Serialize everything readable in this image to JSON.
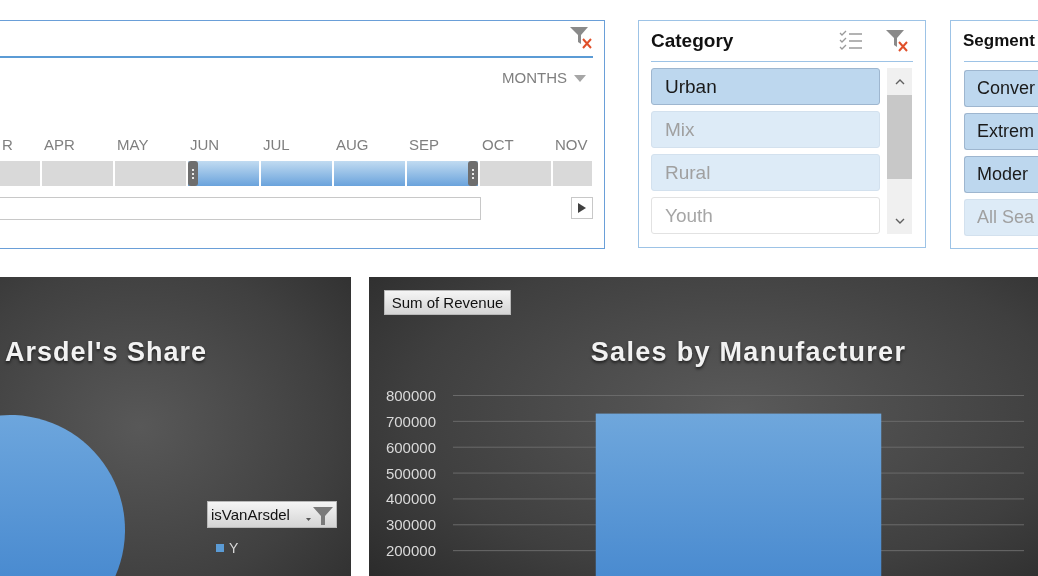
{
  "timeline": {
    "period_label": "MONTHS",
    "months": [
      {
        "label": "R",
        "selected": false
      },
      {
        "label": "APR",
        "selected": false
      },
      {
        "label": "MAY",
        "selected": false
      },
      {
        "label": "JUN",
        "selected": true
      },
      {
        "label": "JUL",
        "selected": true
      },
      {
        "label": "AUG",
        "selected": true
      },
      {
        "label": "SEP",
        "selected": true
      },
      {
        "label": "OCT",
        "selected": false
      },
      {
        "label": "NOV",
        "selected": false
      }
    ]
  },
  "category_slicer": {
    "title": "Category",
    "items": [
      {
        "label": "Urban",
        "selected": true,
        "has_data": true
      },
      {
        "label": "Mix",
        "selected": true,
        "has_data": false
      },
      {
        "label": "Rural",
        "selected": true,
        "has_data": false
      },
      {
        "label": "Youth",
        "selected": false,
        "has_data": false
      }
    ]
  },
  "segment_slicer": {
    "title": "Segment",
    "items": [
      {
        "label": "Conver",
        "selected": true,
        "has_data": true
      },
      {
        "label": "Extrem",
        "selected": true,
        "has_data": true
      },
      {
        "label": "Moder",
        "selected": true,
        "has_data": true
      },
      {
        "label": "All Sea",
        "selected": true,
        "has_data": false
      }
    ]
  },
  "share_chart": {
    "title": "Arsdel's Share",
    "legend_field": "isVanArsdel",
    "legend_items": [
      {
        "label": "Y"
      }
    ]
  },
  "sales_chart": {
    "field_button": "Sum of Revenue",
    "chart_data": {
      "type": "bar",
      "title": "Sales by Manufacturer",
      "values": [
        730000
      ],
      "ylim": [
        100000,
        800000
      ],
      "yticks": [
        200000,
        300000,
        400000,
        500000,
        600000,
        700000,
        800000
      ],
      "grid": true
    }
  }
}
